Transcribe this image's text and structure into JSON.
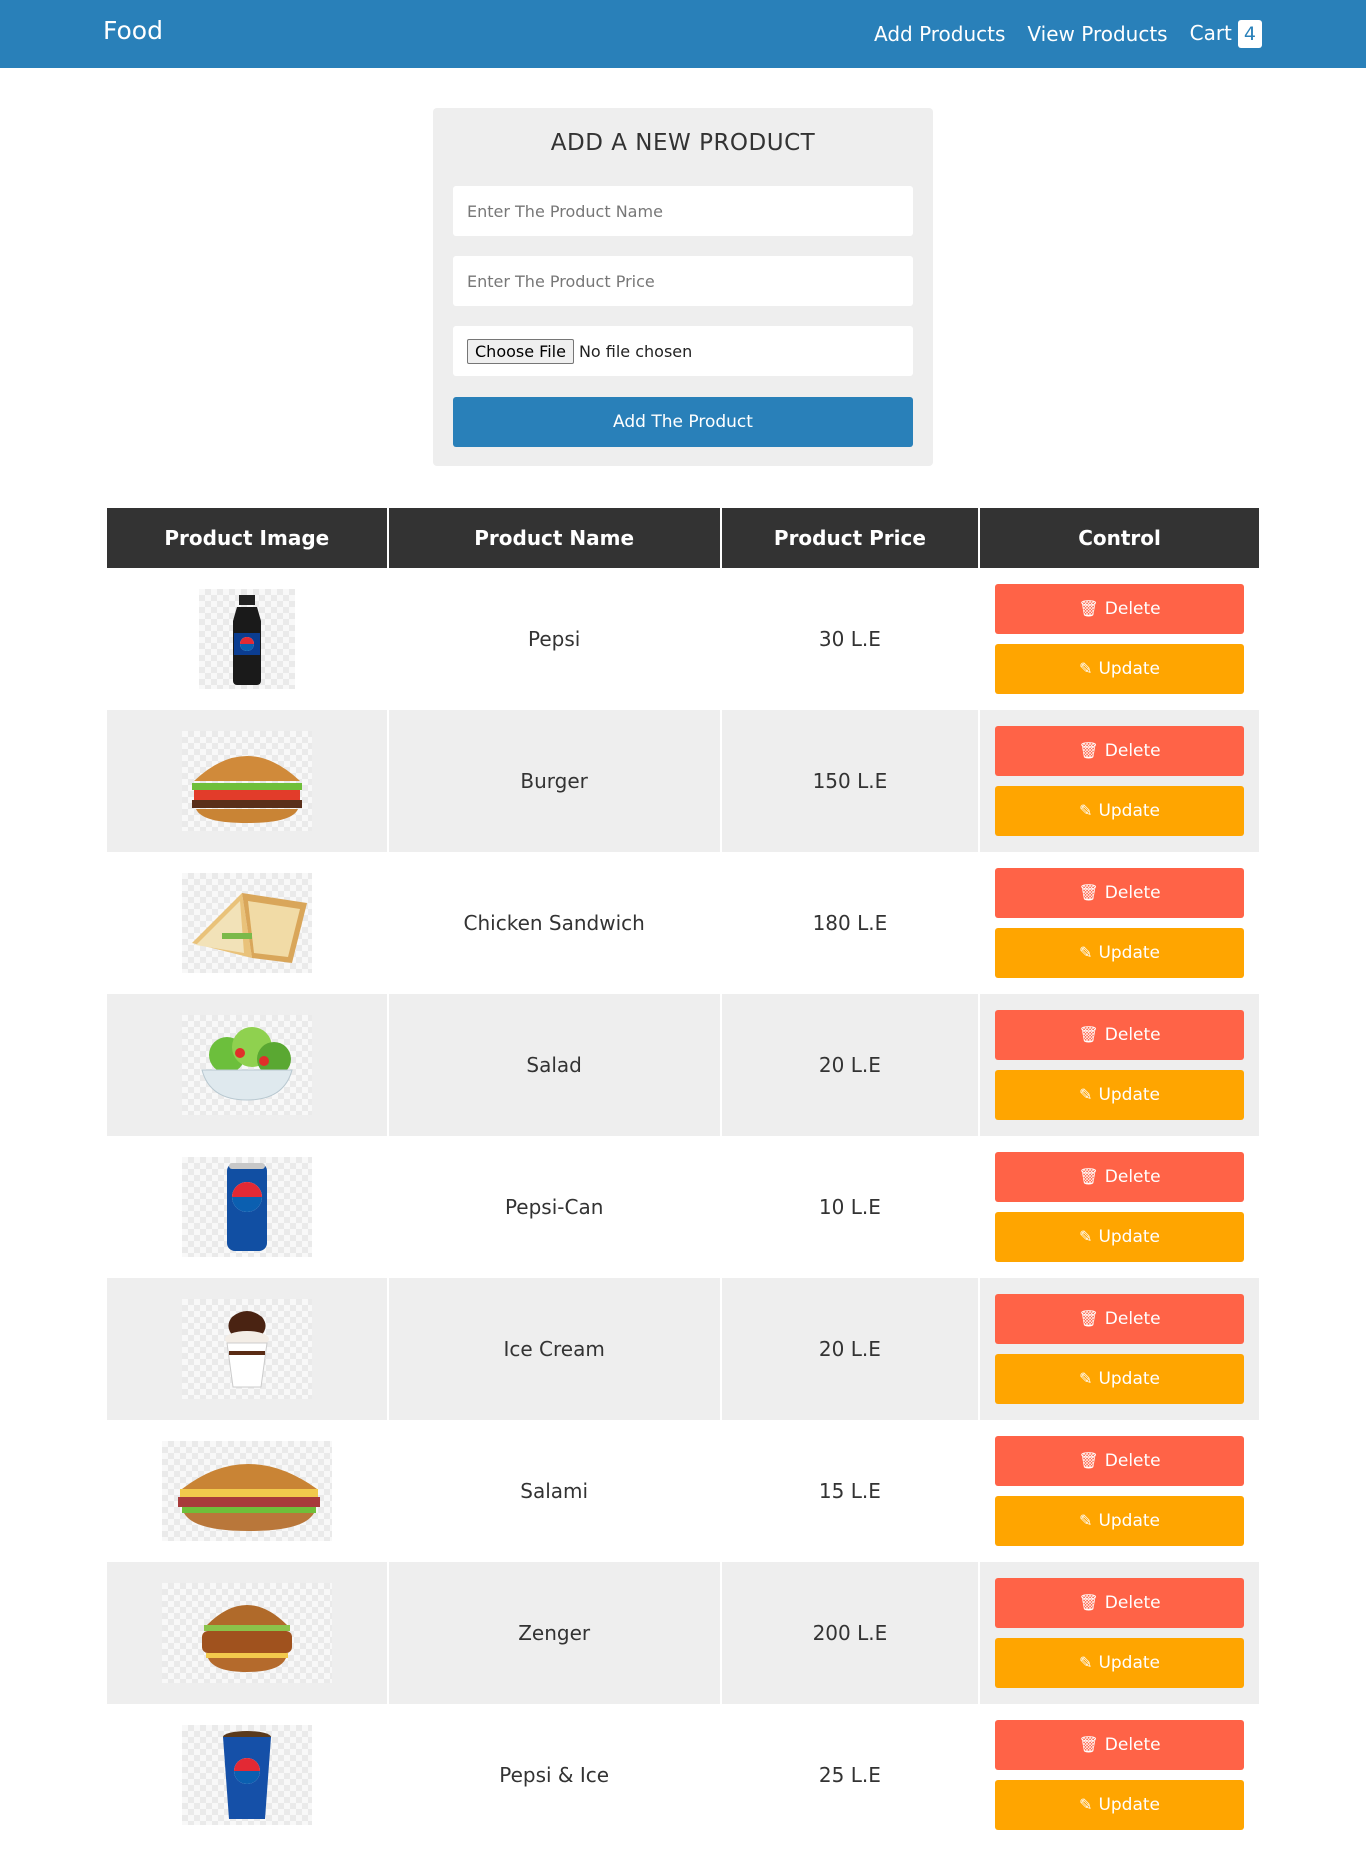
{
  "navbar": {
    "brand": "Food",
    "links": [
      "Add Products",
      "View Products"
    ],
    "cart_label": "Cart",
    "cart_count": "4",
    "color": "#2980b9"
  },
  "form": {
    "title": "ADD A NEW PRODUCT",
    "name_placeholder": "Enter The Product Name",
    "price_placeholder": "Enter The Product Price",
    "file_button": "Choose File",
    "file_status": "No file chosen",
    "submit_label": "Add The Product"
  },
  "table": {
    "headers": [
      "Product Image",
      "Product Name",
      "Product Price",
      "Control"
    ],
    "delete_label": "Delete",
    "update_label": "Update",
    "delete_color": "#ff6347",
    "update_color": "#ffa500",
    "rows": [
      {
        "name": "Pepsi",
        "price": "30 L.E",
        "image": "pepsi-bottle"
      },
      {
        "name": "Burger",
        "price": "150 L.E",
        "image": "burger"
      },
      {
        "name": "Chicken Sandwich",
        "price": "180 L.E",
        "image": "chicken-sandwich"
      },
      {
        "name": "Salad",
        "price": "20 L.E",
        "image": "salad"
      },
      {
        "name": "Pepsi-Can",
        "price": "10 L.E",
        "image": "pepsi-can"
      },
      {
        "name": "Ice Cream",
        "price": "20 L.E",
        "image": "ice-cream"
      },
      {
        "name": "Salami",
        "price": "15 L.E",
        "image": "salami-sandwich"
      },
      {
        "name": "Zenger",
        "price": "200 L.E",
        "image": "zenger-burger"
      },
      {
        "name": "Pepsi & Ice",
        "price": "25 L.E",
        "image": "pepsi-cup"
      }
    ]
  }
}
